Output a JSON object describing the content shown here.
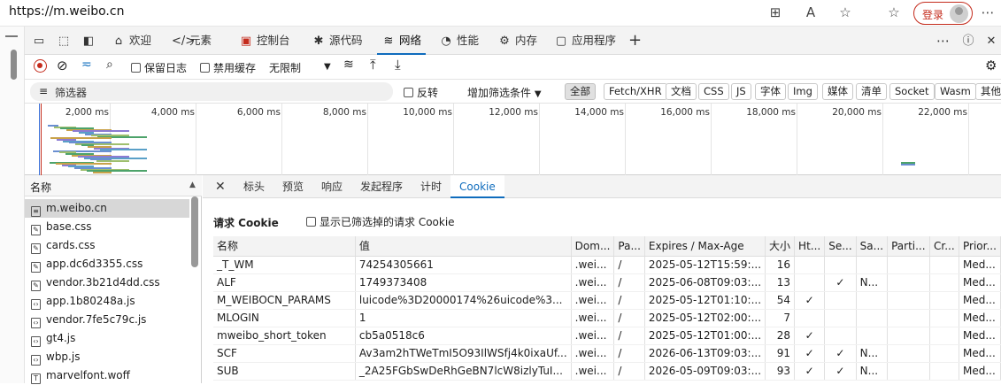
{
  "address_bar": {
    "url": "https://m.weibo.cn",
    "login_label": "登录"
  },
  "devtools_tabs": [
    {
      "icon": "home-icon",
      "label": "欢迎"
    },
    {
      "icon": "code-icon",
      "label": "元素"
    },
    {
      "icon": "console-icon",
      "label": "控制台"
    },
    {
      "icon": "bug-icon",
      "label": "源代码"
    },
    {
      "icon": "wifi-icon",
      "label": "网络"
    },
    {
      "icon": "performance-icon",
      "label": "性能"
    },
    {
      "icon": "memory-icon",
      "label": "内存"
    },
    {
      "icon": "application-icon",
      "label": "应用程序"
    }
  ],
  "network_toolbar": {
    "preserve_log": "保留日志",
    "disable_cache": "禁用缓存",
    "throttling": "无限制"
  },
  "filter": {
    "placeholder": "筛选器",
    "invert": "反转",
    "more_filters": "增加筛选条件",
    "types": [
      "全部",
      "Fetch/XHR",
      "文档",
      "CSS",
      "JS",
      "字体",
      "Img",
      "媒体",
      "清单",
      "Socket",
      "Wasm",
      "其他"
    ]
  },
  "timeline": {
    "ticks": [
      "2,000 ms",
      "4,000 ms",
      "6,000 ms",
      "8,000 ms",
      "10,000 ms",
      "12,000 ms",
      "14,000 ms",
      "16,000 ms",
      "18,000 ms",
      "20,000 ms",
      "22,000 ms"
    ]
  },
  "names_panel": {
    "header": "名称",
    "items": [
      {
        "name": "m.weibo.cn",
        "type": "doc"
      },
      {
        "name": "base.css",
        "type": "css"
      },
      {
        "name": "cards.css",
        "type": "css"
      },
      {
        "name": "app.dc6d3355.css",
        "type": "css"
      },
      {
        "name": "vendor.3b21d4dd.css",
        "type": "css"
      },
      {
        "name": "app.1b80248a.js",
        "type": "js"
      },
      {
        "name": "vendor.7fe5c79c.js",
        "type": "js"
      },
      {
        "name": "gt4.js",
        "type": "js"
      },
      {
        "name": "wbp.js",
        "type": "js"
      },
      {
        "name": "marvelfont.woff",
        "type": "font"
      }
    ]
  },
  "detail_tabs": [
    "标头",
    "预览",
    "响应",
    "发起程序",
    "计时",
    "Cookie"
  ],
  "cookie_section": {
    "title": "请求 Cookie",
    "show_filtered": "显示已筛选掉的请求 Cookie"
  },
  "cookie_table": {
    "columns": [
      "名称",
      "值",
      "Dom...",
      "Pa...",
      "Expires / Max-Age",
      "大小",
      "Ht...",
      "Se...",
      "Sa...",
      "Parti...",
      "Cr...",
      "Prior..."
    ],
    "rows": [
      [
        "_T_WM",
        "74254305661",
        ".wei...",
        "/",
        "2025-05-12T15:59:...",
        "16",
        "",
        "",
        "",
        "",
        "",
        "Med..."
      ],
      [
        "ALF",
        "1749373408",
        ".wei...",
        "/",
        "2025-06-08T09:03:...",
        "13",
        "",
        "✓",
        "N...",
        "",
        "",
        "Med..."
      ],
      [
        "M_WEIBOCN_PARAMS",
        "luicode%3D20000174%26uicode%3...",
        ".wei...",
        "/",
        "2025-05-12T01:10:...",
        "54",
        "✓",
        "",
        "",
        "",
        "",
        "Med..."
      ],
      [
        "MLOGIN",
        "1",
        ".wei...",
        "/",
        "2025-05-12T02:00:...",
        "7",
        "",
        "",
        "",
        "",
        "",
        "Med..."
      ],
      [
        "mweibo_short_token",
        "cb5a0518c6",
        ".wei...",
        "/",
        "2025-05-12T01:00:...",
        "28",
        "✓",
        "",
        "",
        "",
        "",
        "Med..."
      ],
      [
        "SCF",
        "Av3am2hTWeTmI5O93IlWSfj4k0ixaUf...",
        ".wei...",
        "/",
        "2026-06-13T09:03:...",
        "91",
        "✓",
        "✓",
        "N...",
        "",
        "",
        "Med..."
      ],
      [
        "SUB",
        "_2A25FGbSwDeRhGeBN7lcW8izlyTuI...",
        ".wei...",
        "/",
        "2026-05-09T09:03:...",
        "93",
        "✓",
        "✓",
        "N...",
        "",
        "",
        "Med..."
      ]
    ]
  }
}
